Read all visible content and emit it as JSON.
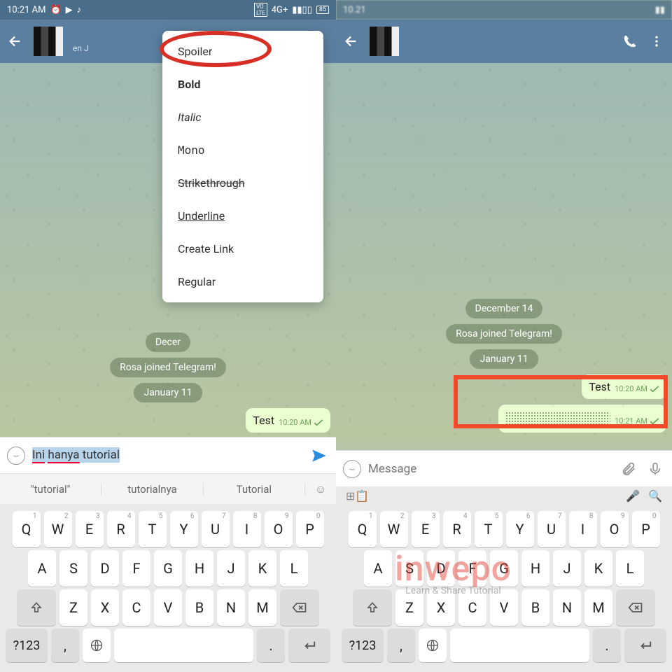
{
  "status": {
    "time": "10:21 AM",
    "net": "4G+",
    "battery": "85"
  },
  "left": {
    "menu": [
      "Spoiler",
      "Bold",
      "Italic",
      "Mono",
      "Strikethrough",
      "Underline",
      "Create Link",
      "Regular"
    ],
    "pills": [
      "Decer",
      "Rosa joined Telegram!",
      "January 11"
    ],
    "bubble_text": "Test",
    "bubble_time": "10:20 AM",
    "input_val1": "Ini",
    "input_val2": "hanya",
    "input_val3": "tutorial",
    "suggestions": [
      "\"tutorial\"",
      "tutorialnya",
      "Tutorial"
    ]
  },
  "right": {
    "pills": [
      "December 14",
      "Rosa joined Telegram!",
      "January 11"
    ],
    "bubble1_text": "Test",
    "bubble1_time": "10:20 AM",
    "bubble2_time": "10:21 AM",
    "placeholder": "Message"
  },
  "kb": {
    "row1": [
      "Q",
      "W",
      "E",
      "R",
      "T",
      "Y",
      "U",
      "I",
      "O",
      "P"
    ],
    "nums": [
      "1",
      "2",
      "3",
      "4",
      "5",
      "6",
      "7",
      "8",
      "9",
      "0"
    ],
    "row2": [
      "A",
      "S",
      "D",
      "F",
      "G",
      "H",
      "J",
      "K",
      "L"
    ],
    "row3": [
      "Z",
      "X",
      "C",
      "V",
      "B",
      "N",
      "M"
    ],
    "sym": "?123"
  },
  "wm": {
    "t": "inwepo",
    "s": "Learn & Share Tutorial"
  }
}
